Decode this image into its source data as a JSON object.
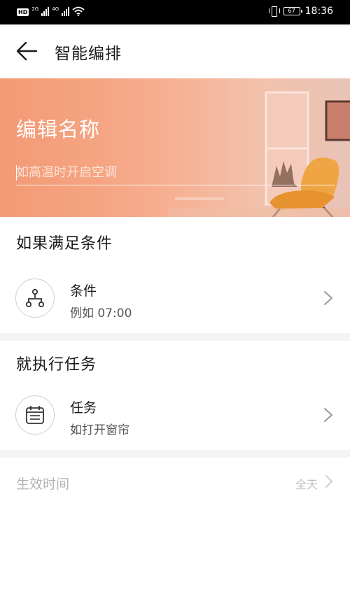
{
  "status_bar": {
    "hd_badge": "HD",
    "net_1": "2G",
    "net_2": "4G",
    "battery": "67",
    "time": "18:36"
  },
  "header": {
    "title": "智能编排"
  },
  "banner": {
    "title": "编辑名称",
    "name_placeholder": "如高温时开启空调"
  },
  "condition_section": {
    "heading": "如果满足条件",
    "item": {
      "title": "条件",
      "subtitle": "例如 07:00",
      "icon": "flow-icon"
    }
  },
  "task_section": {
    "heading": "就执行任务",
    "item": {
      "title": "任务",
      "subtitle": "如打开窗帘",
      "icon": "calendar-icon"
    }
  },
  "effective_time": {
    "label": "生效时间",
    "value": "全天"
  },
  "colors": {
    "banner_start": "#f39a75",
    "banner_end": "#e8c3b6",
    "chair": "#f0a544"
  }
}
